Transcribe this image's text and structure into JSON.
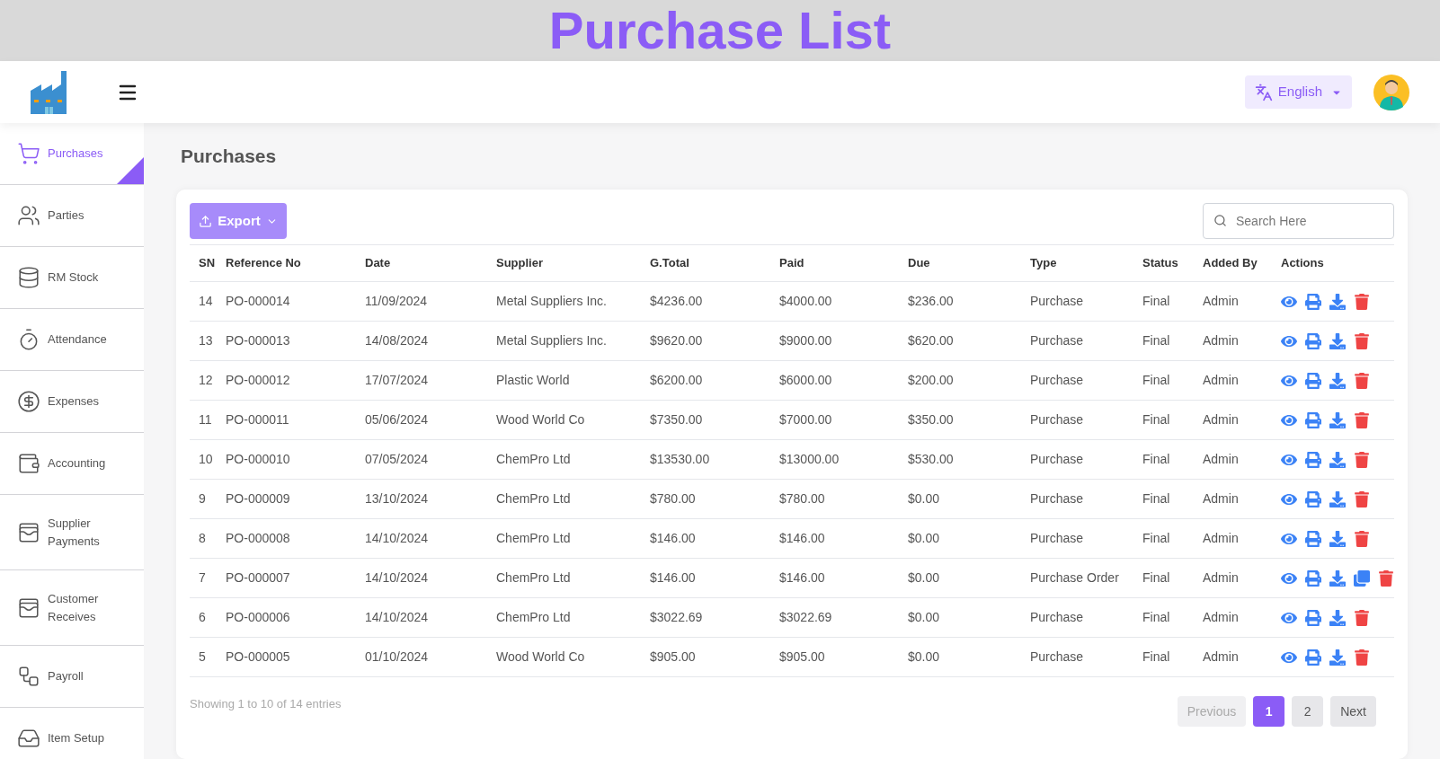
{
  "banner": {
    "title": "Purchase List"
  },
  "header": {
    "language": "English"
  },
  "sidebar": {
    "items": [
      {
        "label": "Purchases",
        "selected": true
      },
      {
        "label": "Parties",
        "selected": false
      },
      {
        "label": "RM Stock",
        "selected": false
      },
      {
        "label": "Attendance",
        "selected": false
      },
      {
        "label": "Expenses",
        "selected": false
      },
      {
        "label": "Accounting",
        "selected": false
      },
      {
        "label": "Supplier Payments",
        "selected": false
      },
      {
        "label": "Customer Receives",
        "selected": false
      },
      {
        "label": "Payroll",
        "selected": false
      },
      {
        "label": "Item Setup",
        "selected": false
      }
    ]
  },
  "page": {
    "title": "Purchases"
  },
  "toolbar": {
    "export": "Export",
    "search": {
      "placeholder": "Search Here"
    }
  },
  "table": {
    "columns": [
      "SN",
      "Reference No",
      "Date",
      "Supplier",
      "G.Total",
      "Paid",
      "Due",
      "Type",
      "Status",
      "Added By",
      "Actions"
    ],
    "rows": [
      {
        "cells": [
          "14",
          "PO-000014",
          "11/09/2024",
          "Metal Suppliers Inc.",
          "$4236.00",
          "$4000.00",
          "$236.00",
          "Purchase",
          "Final",
          "Admin"
        ],
        "actions": [
          {
            "kind": "view"
          },
          {
            "kind": "print"
          },
          {
            "kind": "download"
          },
          {
            "kind": "delete"
          }
        ]
      },
      {
        "cells": [
          "13",
          "PO-000013",
          "14/08/2024",
          "Metal Suppliers Inc.",
          "$9620.00",
          "$9000.00",
          "$620.00",
          "Purchase",
          "Final",
          "Admin"
        ],
        "actions": [
          {
            "kind": "view"
          },
          {
            "kind": "print"
          },
          {
            "kind": "download"
          },
          {
            "kind": "delete"
          }
        ]
      },
      {
        "cells": [
          "12",
          "PO-000012",
          "17/07/2024",
          "Plastic World",
          "$6200.00",
          "$6000.00",
          "$200.00",
          "Purchase",
          "Final",
          "Admin"
        ],
        "actions": [
          {
            "kind": "view"
          },
          {
            "kind": "print"
          },
          {
            "kind": "download"
          },
          {
            "kind": "delete"
          }
        ]
      },
      {
        "cells": [
          "11",
          "PO-000011",
          "05/06/2024",
          "Wood World Co",
          "$7350.00",
          "$7000.00",
          "$350.00",
          "Purchase",
          "Final",
          "Admin"
        ],
        "actions": [
          {
            "kind": "view"
          },
          {
            "kind": "print"
          },
          {
            "kind": "download"
          },
          {
            "kind": "delete"
          }
        ]
      },
      {
        "cells": [
          "10",
          "PO-000010",
          "07/05/2024",
          "ChemPro Ltd",
          "$13530.00",
          "$13000.00",
          "$530.00",
          "Purchase",
          "Final",
          "Admin"
        ],
        "actions": [
          {
            "kind": "view"
          },
          {
            "kind": "print"
          },
          {
            "kind": "download"
          },
          {
            "kind": "delete"
          }
        ]
      },
      {
        "cells": [
          "9",
          "PO-000009",
          "13/10/2024",
          "ChemPro Ltd",
          "$780.00",
          "$780.00",
          "$0.00",
          "Purchase",
          "Final",
          "Admin"
        ],
        "actions": [
          {
            "kind": "view"
          },
          {
            "kind": "print"
          },
          {
            "kind": "download"
          },
          {
            "kind": "delete"
          }
        ]
      },
      {
        "cells": [
          "8",
          "PO-000008",
          "14/10/2024",
          "ChemPro Ltd",
          "$146.00",
          "$146.00",
          "$0.00",
          "Purchase",
          "Final",
          "Admin"
        ],
        "actions": [
          {
            "kind": "view"
          },
          {
            "kind": "print"
          },
          {
            "kind": "download"
          },
          {
            "kind": "delete"
          }
        ]
      },
      {
        "cells": [
          "7",
          "PO-000007",
          "14/10/2024",
          "ChemPro Ltd",
          "$146.00",
          "$146.00",
          "$0.00",
          "Purchase Order",
          "Final",
          "Admin"
        ],
        "actions": [
          {
            "kind": "view"
          },
          {
            "kind": "print"
          },
          {
            "kind": "download"
          },
          {
            "kind": "copy"
          },
          {
            "kind": "delete"
          }
        ]
      },
      {
        "cells": [
          "6",
          "PO-000006",
          "14/10/2024",
          "ChemPro Ltd",
          "$3022.69",
          "$3022.69",
          "$0.00",
          "Purchase",
          "Final",
          "Admin"
        ],
        "actions": [
          {
            "kind": "view"
          },
          {
            "kind": "print"
          },
          {
            "kind": "download"
          },
          {
            "kind": "delete"
          }
        ]
      },
      {
        "cells": [
          "5",
          "PO-000005",
          "01/10/2024",
          "Wood World Co",
          "$905.00",
          "$905.00",
          "$0.00",
          "Purchase",
          "Final",
          "Admin"
        ],
        "actions": [
          {
            "kind": "view"
          },
          {
            "kind": "print"
          },
          {
            "kind": "download"
          },
          {
            "kind": "delete"
          }
        ]
      }
    ]
  },
  "footer": {
    "info": "Showing 1 to 10 of 14 entries",
    "previous": {
      "label": "Previous",
      "disabled": true
    },
    "pages": [
      {
        "label": "1",
        "selected": true
      },
      {
        "label": "2",
        "selected": false
      }
    ],
    "next": {
      "label": "Next",
      "disabled": false
    }
  }
}
